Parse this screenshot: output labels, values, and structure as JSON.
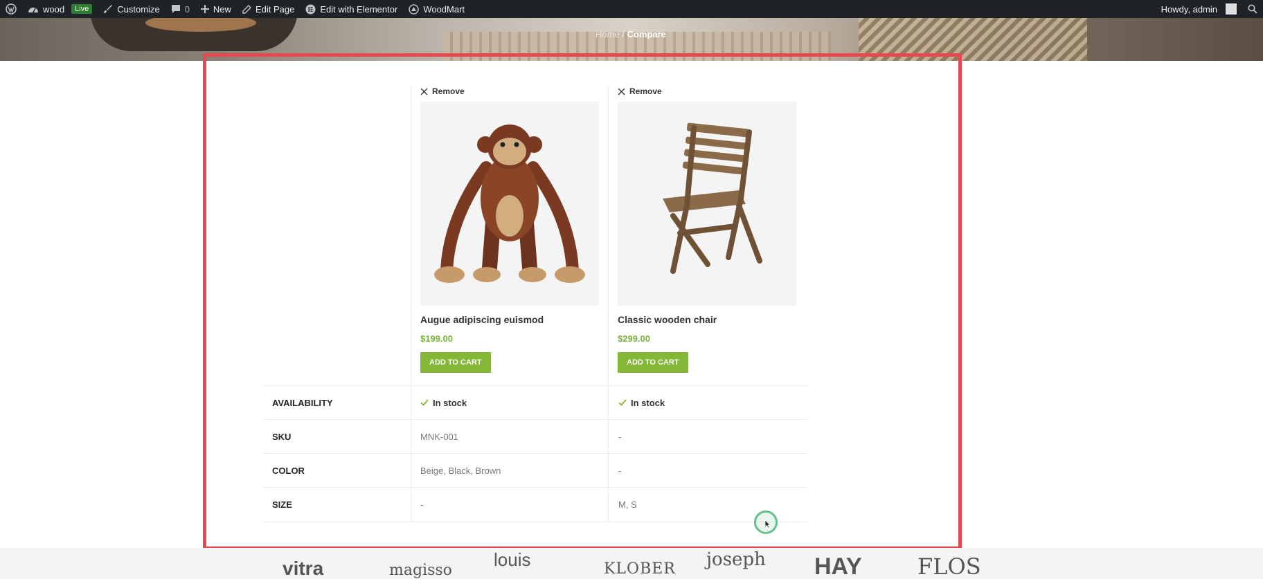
{
  "admin_bar": {
    "site_name": "wood",
    "live_badge": "Live",
    "customize": "Customize",
    "comments_count": "0",
    "new": "New",
    "edit_page": "Edit Page",
    "edit_elementor": "Edit with Elementor",
    "woodmart": "WoodMart",
    "greeting": "Howdy, admin"
  },
  "hero": {
    "breadcrumb_home": "Home",
    "breadcrumb_separator": "/",
    "breadcrumb_current": "Compare"
  },
  "compare": {
    "products": [
      {
        "remove": "Remove",
        "name": "Augue adipiscing euismod",
        "price": "$199.00",
        "cart": "ADD TO CART",
        "image": "wooden-monkey"
      },
      {
        "remove": "Remove",
        "name": "Classic wooden chair",
        "price": "$299.00",
        "cart": "ADD TO CART",
        "image": "wooden-chair"
      }
    ],
    "rows": [
      {
        "label": "AVAILABILITY",
        "values": [
          "In stock",
          "In stock"
        ]
      },
      {
        "label": "SKU",
        "values": [
          "MNK-001",
          "-"
        ]
      },
      {
        "label": "COLOR",
        "values": [
          "Beige, Black, Brown",
          "-"
        ]
      },
      {
        "label": "SIZE",
        "values": [
          "-",
          "M, S"
        ]
      }
    ]
  },
  "brands": [
    "vitra",
    "magisso",
    "louis",
    "KLOBER",
    "joseph",
    "HAY",
    "FLOS"
  ],
  "colors": {
    "accent_green": "#83b735",
    "price_green": "#7bb43a",
    "highlight_red": "#e8484f",
    "admin_bar_bg": "#1d2327"
  }
}
